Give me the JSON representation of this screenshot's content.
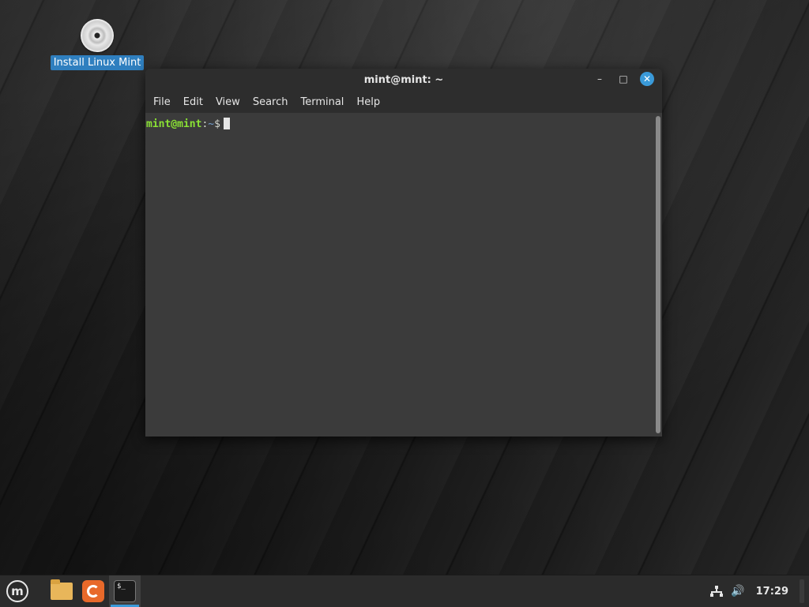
{
  "desktop": {
    "icons": [
      {
        "label": "Install Linux Mint",
        "icon": "disc-icon"
      }
    ]
  },
  "terminal": {
    "title": "mint@mint: ~",
    "controls": {
      "minimize": "–",
      "maximize": "□",
      "close": "✕"
    },
    "menu": [
      "File",
      "Edit",
      "View",
      "Search",
      "Terminal",
      "Help"
    ],
    "prompt": {
      "user_host": "mint@mint",
      "colon": ":",
      "path": "~",
      "symbol": "$"
    },
    "scroll_fraction": 1.0
  },
  "panel": {
    "menu_icon": "linux-mint-logo-icon",
    "menu_glyph": "m",
    "launchers": [
      {
        "name": "files",
        "icon": "folder-icon"
      },
      {
        "name": "firefox",
        "icon": "firefox-icon"
      },
      {
        "name": "terminal",
        "icon": "terminal-icon",
        "glyph": "$_",
        "running": true
      }
    ],
    "tray": {
      "network_icon": "network-icon",
      "volume_icon": "volume-icon",
      "volume_glyph": "🔊",
      "clock": "17:29"
    }
  },
  "colors": {
    "accent": "#3a9ad9",
    "prompt_user": "#8ae234",
    "prompt_path": "#729fcf",
    "terminal_bg": "#3b3b3b",
    "panel_bg": "#2b2b2b"
  }
}
